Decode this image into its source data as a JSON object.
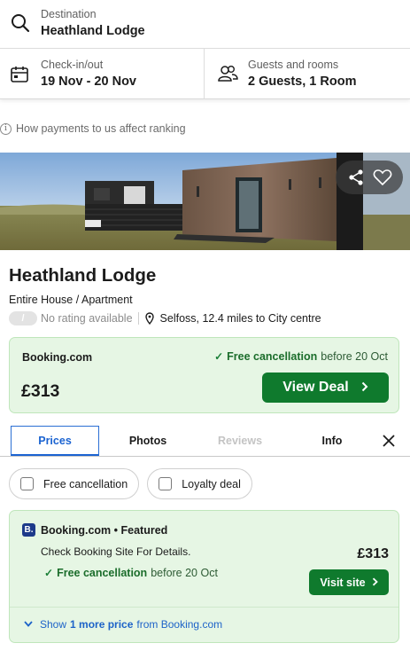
{
  "search": {
    "destination_label": "Destination",
    "destination_value": "Heathland Lodge",
    "dates_label": "Check-in/out",
    "dates_value": "19 Nov - 20 Nov",
    "guests_label": "Guests and rooms",
    "guests_value": "2 Guests, 1 Room"
  },
  "ranking_notice": "How payments to us affect ranking",
  "hotel": {
    "name": "Heathland Lodge",
    "type": "Entire House / Apartment",
    "rating_badge": "/",
    "rating_text": "No rating available",
    "location": "Selfoss, 12.4 miles to City centre"
  },
  "top_deal": {
    "provider": "Booking.com",
    "cancel_bold": "Free cancellation",
    "cancel_rest": "before 20 Oct",
    "price": "£313",
    "button": "View Deal"
  },
  "tabs": [
    {
      "label": "Prices",
      "active": true
    },
    {
      "label": "Photos",
      "active": false
    },
    {
      "label": "Reviews",
      "active": false,
      "disabled": true
    },
    {
      "label": "Info",
      "active": false
    }
  ],
  "filters": [
    {
      "label": "Free cancellation",
      "checked": false
    },
    {
      "label": "Loyalty deal",
      "checked": false
    }
  ],
  "offer": {
    "logo_letter": "B.",
    "title": "Booking.com • Featured",
    "description": "Check Booking Site For Details.",
    "cancel_bold": "Free cancellation",
    "cancel_rest": "before 20 Oct",
    "price": "£313",
    "button": "Visit site",
    "more_prefix": "Show",
    "more_bold": "1 more price",
    "more_suffix": "from Booking.com"
  },
  "colors": {
    "accent_green": "#0f7a2d",
    "deal_background": "#e6f6e4",
    "link_blue": "#1d63c8"
  }
}
